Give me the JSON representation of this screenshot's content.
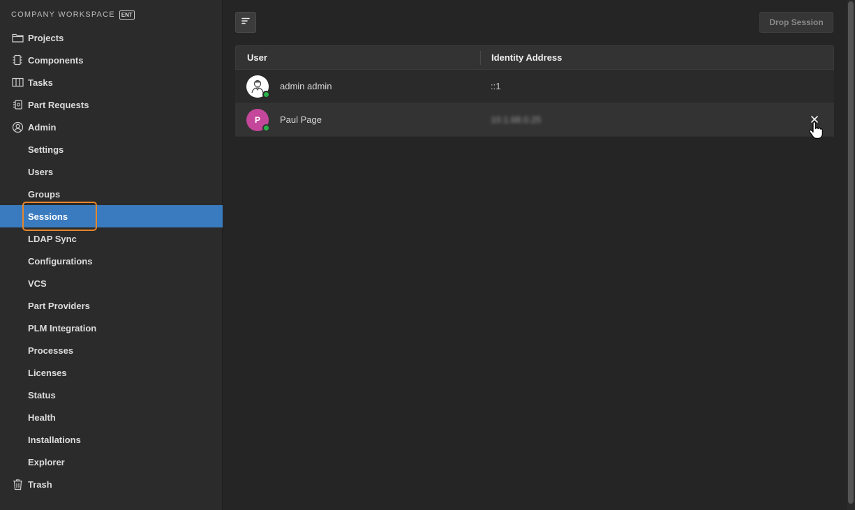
{
  "workspace": {
    "title": "COMPANY WORKSPACE",
    "badge": "ENT"
  },
  "nav": {
    "projects": "Projects",
    "components": "Components",
    "tasks": "Tasks",
    "part_requests": "Part Requests",
    "admin": "Admin",
    "admin_items": {
      "settings": "Settings",
      "users": "Users",
      "groups": "Groups",
      "sessions": "Sessions",
      "ldap_sync": "LDAP Sync",
      "configurations": "Configurations",
      "vcs": "VCS",
      "part_providers": "Part Providers",
      "plm_integration": "PLM Integration",
      "processes": "Processes",
      "licenses": "Licenses",
      "status": "Status",
      "health": "Health",
      "installations": "Installations",
      "explorer": "Explorer"
    },
    "trash": "Trash",
    "active": "Sessions"
  },
  "toolbar": {
    "drop_session_label": "Drop Session"
  },
  "table": {
    "headers": {
      "user": "User",
      "identity_address": "Identity Address"
    },
    "rows": [
      {
        "user": "admin admin",
        "address": "::1",
        "avatar": "user-portrait-icon",
        "online": true
      },
      {
        "user": "Paul Page",
        "address": "10.1.68.0.25",
        "avatar_initial": "P",
        "avatar_color": "#c4479b",
        "online": true
      }
    ]
  },
  "colors": {
    "accent": "#3a7bbf",
    "highlight": "#e6862a",
    "online": "#2bb34a"
  }
}
